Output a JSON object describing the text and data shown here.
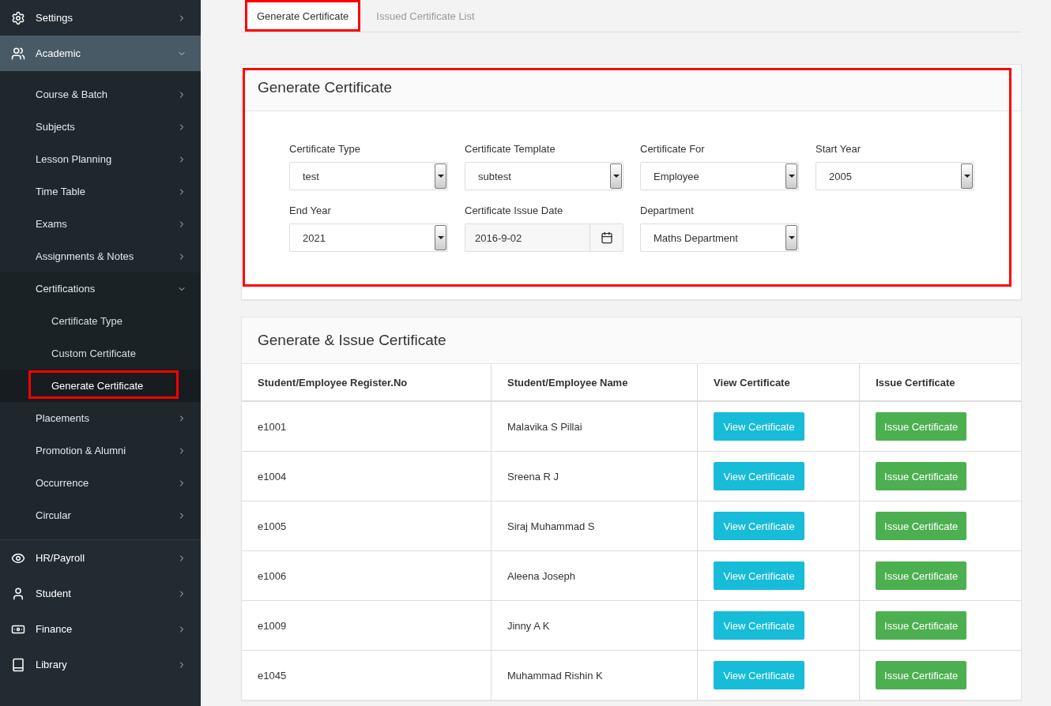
{
  "sidebar": {
    "items": [
      {
        "label": "Settings",
        "expanded": false
      },
      {
        "label": "Academic",
        "expanded": true,
        "children": [
          {
            "label": "Course & Batch",
            "expanded": false
          },
          {
            "label": "Subjects",
            "expanded": false
          },
          {
            "label": "Lesson Planning",
            "expanded": false
          },
          {
            "label": "Time Table",
            "expanded": false
          },
          {
            "label": "Exams",
            "expanded": false
          },
          {
            "label": "Assignments & Notes",
            "expanded": false
          },
          {
            "label": "Certifications",
            "expanded": true,
            "children": [
              {
                "label": "Certificate Type",
                "selected": false,
                "highlighted": false
              },
              {
                "label": "Custom Certificate",
                "selected": false,
                "highlighted": false
              },
              {
                "label": "Generate Certificate",
                "selected": true,
                "highlighted": true
              }
            ]
          },
          {
            "label": "Placements",
            "expanded": false
          },
          {
            "label": "Promotion & Alumni",
            "expanded": false
          },
          {
            "label": "Occurrence",
            "expanded": false
          },
          {
            "label": "Circular",
            "expanded": false
          }
        ]
      },
      {
        "label": "HR/Payroll",
        "expanded": false
      },
      {
        "label": "Student",
        "expanded": false
      },
      {
        "label": "Finance",
        "expanded": false
      },
      {
        "label": "Library",
        "expanded": false
      }
    ]
  },
  "tabs": [
    {
      "label": "Generate Certificate",
      "selected": true,
      "highlighted": true
    },
    {
      "label": "Issued Certificate List",
      "selected": false,
      "highlighted": false
    }
  ],
  "generate_card": {
    "title": "Generate Certificate",
    "highlighted": true,
    "fields": [
      {
        "label": "Certificate Type",
        "value": "test",
        "kind": "select"
      },
      {
        "label": "Certificate Template",
        "value": "subtest",
        "kind": "select"
      },
      {
        "label": "Certificate For",
        "value": "Employee",
        "kind": "select"
      },
      {
        "label": "Start Year",
        "value": "2005",
        "kind": "select"
      },
      {
        "label": "End Year",
        "value": "2021",
        "kind": "select"
      },
      {
        "label": "Certificate Issue Date",
        "value": "2016-9-02",
        "kind": "date"
      },
      {
        "label": "Department",
        "value": "Maths Department",
        "kind": "select"
      }
    ]
  },
  "issue_card": {
    "title": "Generate & Issue Certificate",
    "columns": [
      "Student/Employee Register.No",
      "Student/Employee Name",
      "View Certificate",
      "Issue Certificate"
    ],
    "rows": [
      {
        "register_no": "e1001",
        "name": "Malavika S Pillai",
        "view": "View Certificate",
        "issue": "Issue Certificate"
      },
      {
        "register_no": "e1004",
        "name": "Sreena R J",
        "view": "View Certificate",
        "issue": "Issue Certificate"
      },
      {
        "register_no": "e1005",
        "name": "Siraj Muhammad S",
        "view": "View Certificate",
        "issue": "Issue Certificate"
      },
      {
        "register_no": "e1006",
        "name": "Aleena Joseph",
        "view": "View Certificate",
        "issue": "Issue Certificate"
      },
      {
        "register_no": "e1009",
        "name": "Jinny A K",
        "view": "View Certificate",
        "issue": "Issue Certificate"
      },
      {
        "register_no": "e1045",
        "name": "Muhammad Rishin K",
        "view": "View Certificate",
        "issue": "Issue Certificate"
      }
    ]
  }
}
